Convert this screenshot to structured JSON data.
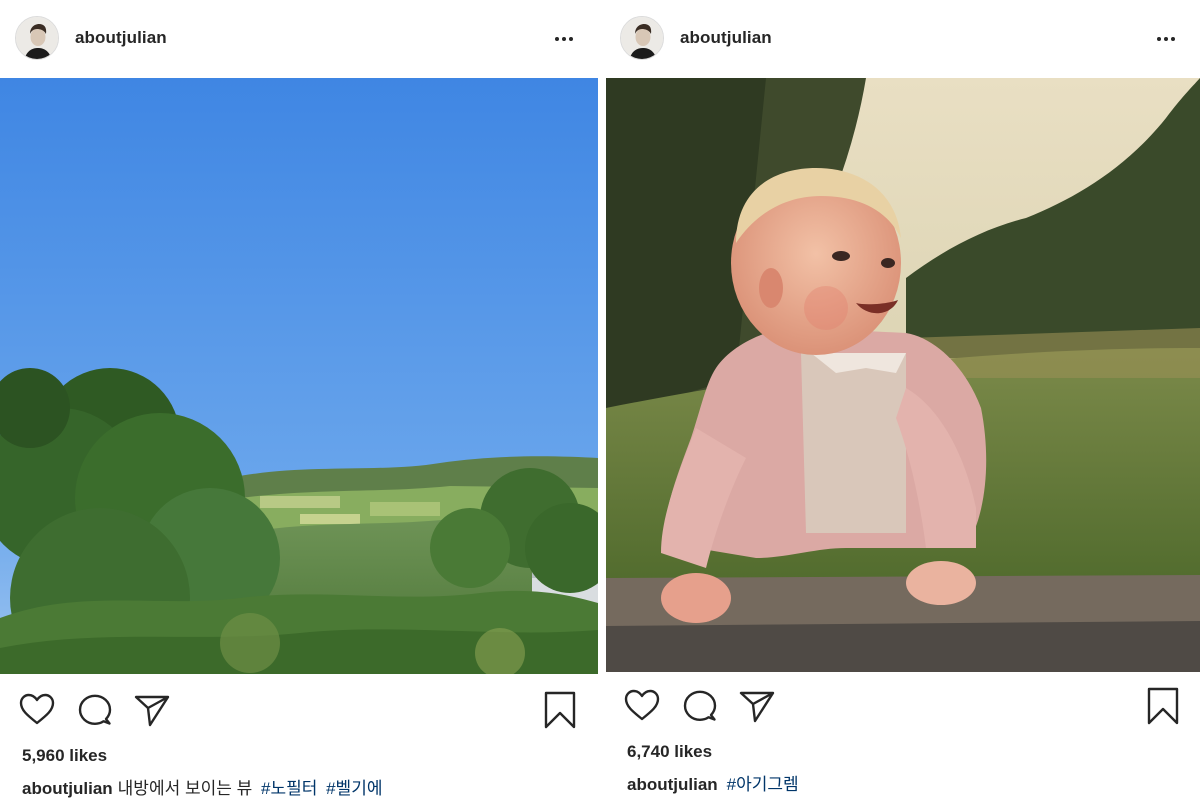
{
  "posts": [
    {
      "username": "aboutjulian",
      "likes": "5,960 likes",
      "caption": {
        "username": "aboutjulian",
        "text": "내방에서 보이는 뷰",
        "hashtags": [
          "#노필터",
          "#벨기에"
        ]
      },
      "actions": [
        "heart-icon",
        "comment-icon",
        "share-icon",
        "bookmark-icon"
      ]
    },
    {
      "username": "aboutjulian",
      "likes": "6,740 likes",
      "caption": {
        "username": "aboutjulian",
        "text": "",
        "hashtags": [
          "#아기그렘"
        ]
      },
      "actions": [
        "heart-icon",
        "comment-icon",
        "share-icon",
        "bookmark-icon"
      ]
    }
  ],
  "colors": {
    "text": "#262626",
    "hashtag": "#003569",
    "sky": "#4d8fe0",
    "border": "#dbdbdb"
  }
}
